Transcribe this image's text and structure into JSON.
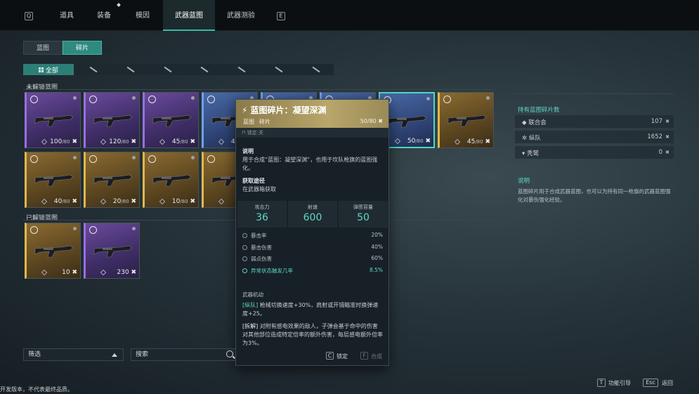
{
  "nav": {
    "key_left": "Q",
    "key_right": "E",
    "tabs": [
      "道具",
      "装备",
      "模因",
      "武器蓝图",
      "武器测验"
    ],
    "active_index": 3
  },
  "subtabs": {
    "items": [
      "蓝图",
      "碎片"
    ],
    "active_index": 1
  },
  "filter": {
    "all_label": "全部"
  },
  "sections": {
    "unlocked_not": "未解锁蓝图",
    "unlocked": "已解锁蓝图"
  },
  "cards_locked_row1": [
    {
      "count": "100",
      "den": "/80",
      "color": "purple"
    },
    {
      "count": "120",
      "den": "/80",
      "color": "purple"
    },
    {
      "count": "45",
      "den": "/80",
      "color": "purple"
    },
    {
      "count": "45",
      "den": "/80",
      "color": "blue"
    },
    {
      "count": "",
      "den": "",
      "color": "blue"
    },
    {
      "count": "",
      "den": "",
      "color": "blue"
    },
    {
      "count": "50",
      "den": "/80",
      "color": "blue"
    },
    {
      "count": "45",
      "den": "/80",
      "color": "gold"
    }
  ],
  "cards_locked_row2": [
    {
      "count": "40",
      "den": "/80",
      "color": "gold"
    },
    {
      "count": "20",
      "den": "/80",
      "color": "gold"
    },
    {
      "count": "10",
      "den": "/80",
      "color": "gold"
    },
    {
      "count": "7",
      "den": "",
      "color": "gold"
    }
  ],
  "cards_unlocked": [
    {
      "count": "10",
      "den": "",
      "color": "gold"
    },
    {
      "count": "230",
      "den": "",
      "color": "purple"
    }
  ],
  "tooltip": {
    "title": "蓝图碎片：凝望深渊",
    "type1": "蓝图",
    "type2": "碎片",
    "count": "50/80",
    "lock_text": "锁定:关",
    "desc_h": "说明",
    "desc": "用于合成“蓝图：凝望深渊”，也用于坎队枪旗的蓝图强化。",
    "source_h": "获取途径",
    "source": "在武器箱获取",
    "stats": [
      {
        "label": "攻击力",
        "value": "36"
      },
      {
        "label": "射速",
        "value": "600"
      },
      {
        "label": "弹匣容量",
        "value": "50"
      }
    ],
    "rows": [
      {
        "label": "暴击率",
        "value": "20%",
        "hl": false
      },
      {
        "label": "暴击伤害",
        "value": "40%",
        "hl": false
      },
      {
        "label": "弱点伤害",
        "value": "60%",
        "hl": false
      },
      {
        "label": "异常状态触发几率",
        "value": "8.5%",
        "hl": true
      }
    ],
    "mech_h": "武器机动",
    "mech1_tag": "[纵队]",
    "mech1": "枪械切换速度+30%，肩射或开镜瞄准时换弹速度+25。",
    "mech2_tag": "[拆解]",
    "mech2": "对附有感电效果的敌人，子弹会基于命中的伤害对其他部位造成特定倍率的额外伤害，每层感电额外倍率为3%。",
    "lock_key": "C",
    "lock_label": "锁定",
    "craft_key": "F",
    "craft_label": "合成"
  },
  "right_panel": {
    "title": "持有蓝图碎片数",
    "rows": [
      {
        "name": "联合会",
        "value": "107"
      },
      {
        "name": "纵队",
        "value": "1652"
      },
      {
        "name": "秃鹫",
        "value": "0"
      }
    ],
    "desc_h": "说明",
    "desc": "蓝图碎片用于合成武器蓝图，也可以为持有同一枪旗的武器蓝图强化对暴伤强化经验。"
  },
  "bottom": {
    "filter_label": "筛选",
    "search_placeholder": "搜索",
    "guide_key": "T",
    "guide_label": "功能引导",
    "back_key": "Esc",
    "back_label": "返回",
    "disclaimer": "开发版本，不代表最终品质。"
  }
}
